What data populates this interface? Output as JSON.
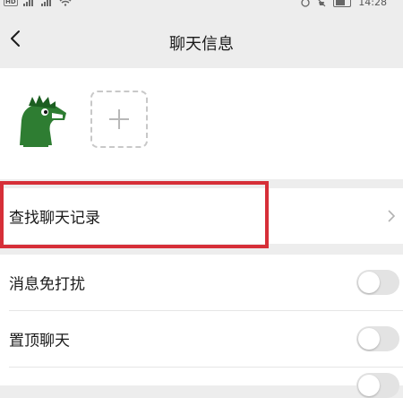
{
  "status_bar": {
    "hd_label": "HD",
    "time": "14:28"
  },
  "header": {
    "title": "聊天信息"
  },
  "members": {
    "avatar_alt": "green dinosaur avatar"
  },
  "search_section": {
    "find_history_label": "查找聊天记录"
  },
  "settings_section": {
    "items": [
      {
        "label": "消息免打扰",
        "enabled": false
      },
      {
        "label": "置顶聊天",
        "enabled": false
      }
    ]
  },
  "colors": {
    "highlight": "#d62f38",
    "background": "#ededed",
    "avatar_green": "#2e7d32"
  },
  "icons": [
    "back-icon",
    "plus-icon",
    "chevron-right-icon"
  ]
}
